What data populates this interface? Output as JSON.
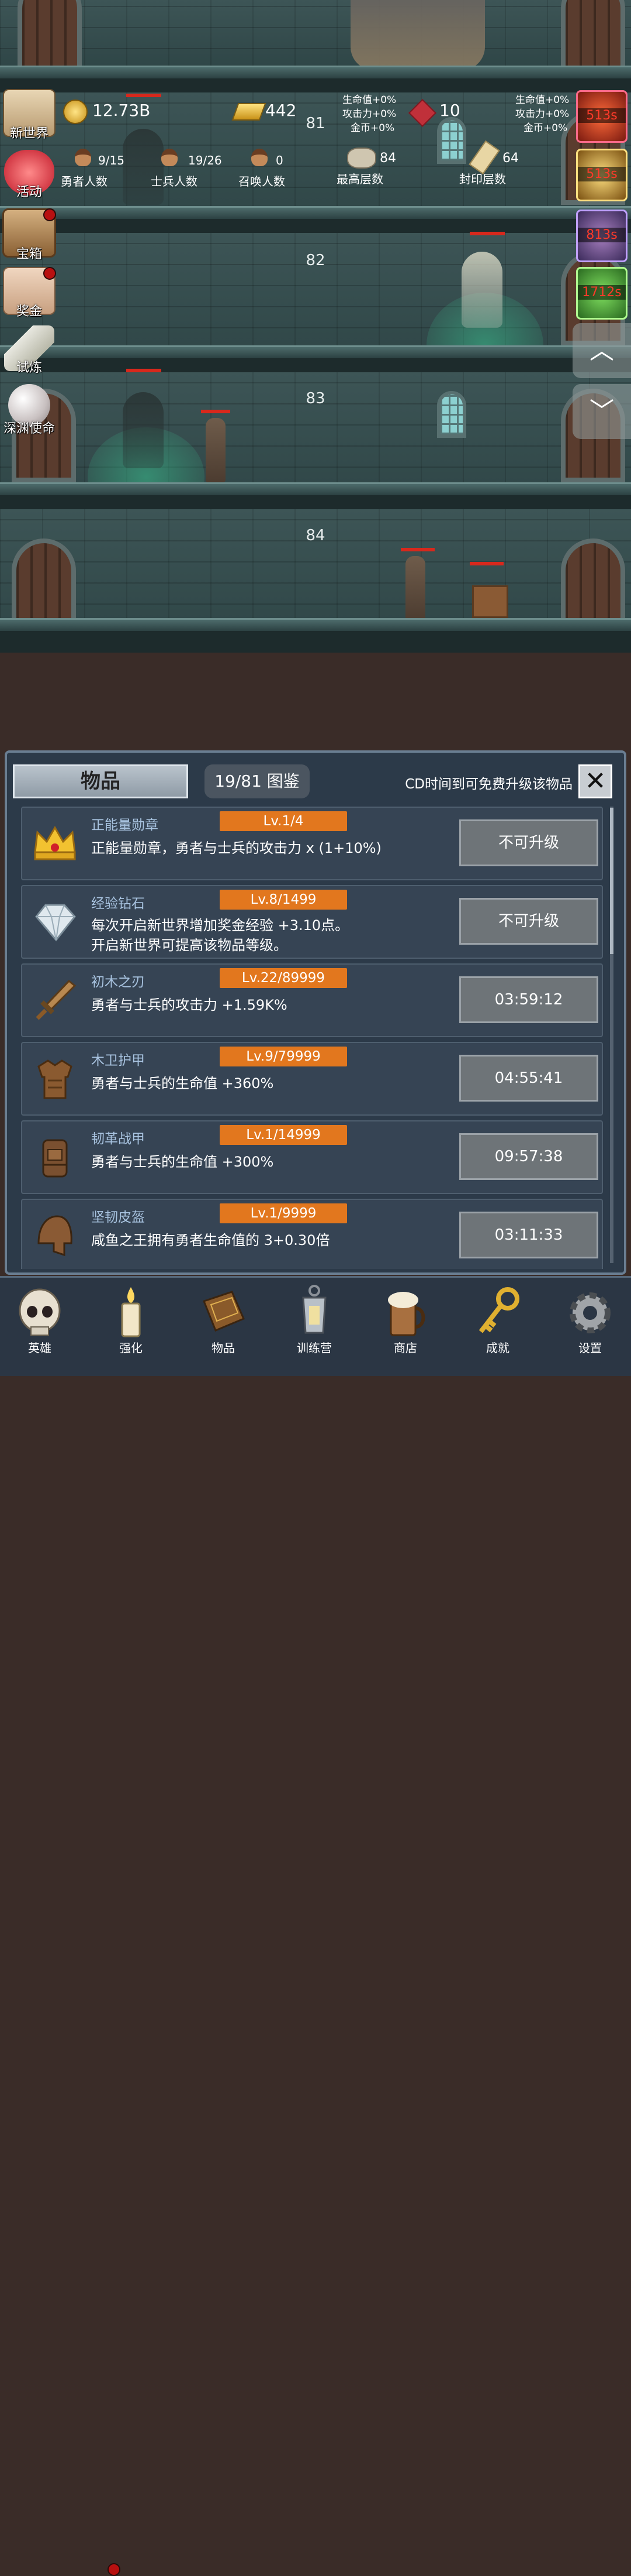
{
  "hud": {
    "gold": "12.73B",
    "gold_bars": "442",
    "gems": "10",
    "buff_left": [
      "生命值+0%",
      "攻击力+0%",
      "金币+0%"
    ],
    "buff_right": [
      "生命值+0%",
      "攻击力+0%",
      "金币+0%"
    ],
    "hero_count": "9/15",
    "hero_label": "勇者人数",
    "soldier_count": "19/26",
    "soldier_label": "士兵人数",
    "summon_count": "0",
    "summon_label": "召唤人数",
    "max_floor": "84",
    "max_floor_label": "最高层数",
    "sealed_floor": "64",
    "sealed_floor_label": "封印层数"
  },
  "floors": [
    "81",
    "82",
    "83",
    "84"
  ],
  "side_menu": [
    {
      "label": "新世界",
      "icon": "map-icon"
    },
    {
      "label": "活动",
      "icon": "heart-icon"
    },
    {
      "label": "宝箱",
      "icon": "chest-icon",
      "badge": true
    },
    {
      "label": "奖金",
      "icon": "envelope-icon",
      "badge": true
    },
    {
      "label": "试炼",
      "icon": "feather-icon"
    },
    {
      "label": "深渊使命",
      "icon": "pearl-icon"
    }
  ],
  "timers": [
    "513s",
    "513s",
    "813s",
    "1712s"
  ],
  "panel": {
    "title": "物品",
    "collection": "19/81 图鉴",
    "cd_hint": "CD时间到可免费升级该物品",
    "close": "✕",
    "items": [
      {
        "name": "正能量勋章",
        "level": "Lv.1/4",
        "desc": [
          "正能量勋章，勇者与士兵的攻击力 x (1+10%)"
        ],
        "action": "不可升级",
        "icon": "crown-icon"
      },
      {
        "name": "经验钻石",
        "level": "Lv.8/1499",
        "desc": [
          "每次开启新世界增加奖金经验 +3.10点。",
          "开启新世界可提高该物品等级。"
        ],
        "action": "不可升级",
        "icon": "diamond-icon"
      },
      {
        "name": "初木之刃",
        "level": "Lv.22/89999",
        "desc": [
          "勇者与士兵的攻击力 +1.59K%"
        ],
        "action": "03:59:12",
        "icon": "wooden-sword-icon"
      },
      {
        "name": "木卫护甲",
        "level": "Lv.9/79999",
        "desc": [
          "勇者与士兵的生命值 +360%"
        ],
        "action": "04:55:41",
        "icon": "wooden-armor-icon"
      },
      {
        "name": "韧革战甲",
        "level": "Lv.1/14999",
        "desc": [
          "勇者与士兵的生命值 +300%"
        ],
        "action": "09:57:38",
        "icon": "leather-armor-icon"
      },
      {
        "name": "坚韧皮盔",
        "level": "Lv.1/9999",
        "desc": [
          "咸鱼之王拥有勇者生命值的 3+0.30倍"
        ],
        "action": "03:11:33",
        "icon": "leather-helmet-icon"
      }
    ]
  },
  "nav": [
    {
      "label": "英雄",
      "icon": "skull-icon"
    },
    {
      "label": "强化",
      "icon": "candle-icon",
      "badge": true
    },
    {
      "label": "物品",
      "icon": "book-icon"
    },
    {
      "label": "训练营",
      "icon": "lantern-icon"
    },
    {
      "label": "商店",
      "icon": "beer-mug-icon"
    },
    {
      "label": "成就",
      "icon": "key-icon"
    },
    {
      "label": "设置",
      "icon": "gear-icon"
    }
  ],
  "colors": {
    "level_badge": "#e2771e",
    "panel_bg": "#2c3a49",
    "timer_text": "#ff3a2a",
    "item_name": "#a8c3e0"
  }
}
